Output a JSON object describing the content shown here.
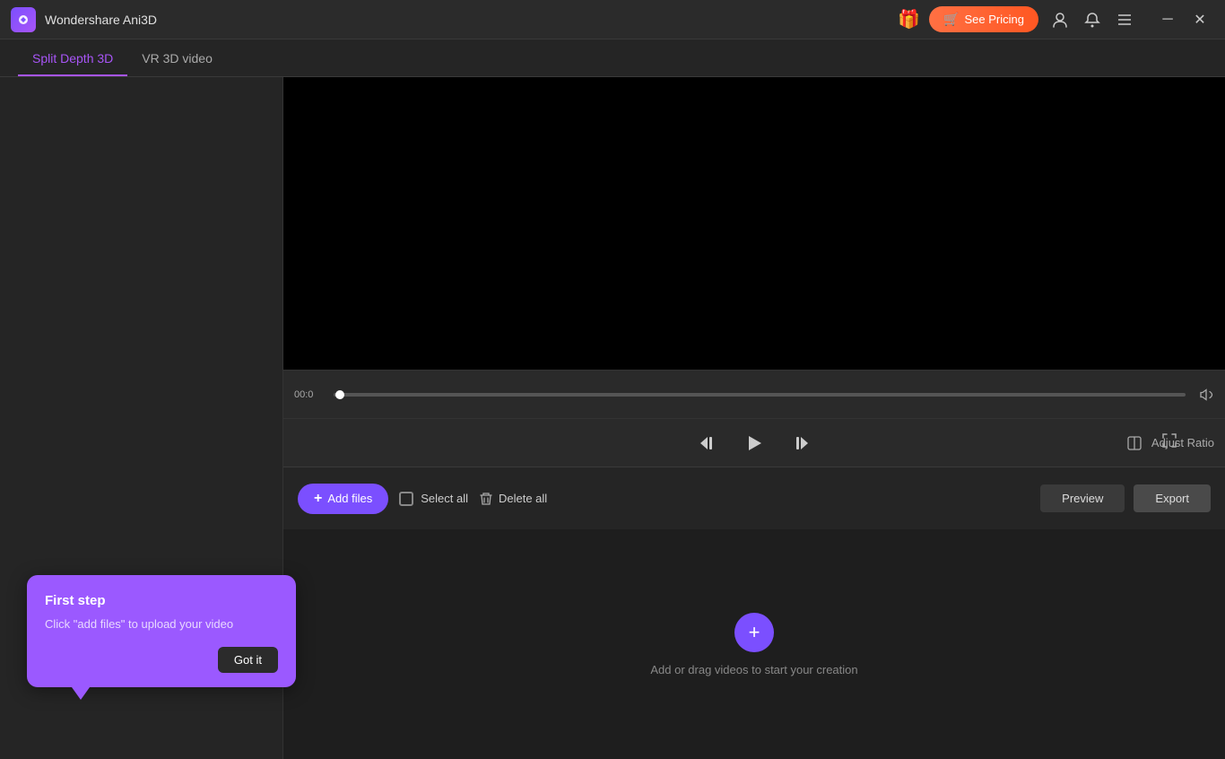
{
  "titleBar": {
    "appName": "Wondershare Ani3D",
    "giftIcon": "🎁",
    "seePricingLabel": "See Pricing",
    "cartIcon": "🛒",
    "userIcon": "👤",
    "bellIcon": "🔔",
    "menuIcon": "≡",
    "minimizeIcon": "─",
    "closeIcon": "✕"
  },
  "tabs": [
    {
      "label": "Split Depth 3D",
      "active": true
    },
    {
      "label": "VR 3D video",
      "active": false
    }
  ],
  "timeline": {
    "timeStart": "00:0"
  },
  "controls": {
    "skipBackIcon": "⏮",
    "playIcon": "▶",
    "skipForwardIcon": "⏭",
    "fullscreenIcon": "⛶",
    "adjustRatioLabel": "Adjust Ratio"
  },
  "fileBar": {
    "addFilesLabel": "Add files",
    "selectAllLabel": "Select all",
    "deleteAllLabel": "Delete all",
    "previewLabel": "Preview",
    "exportLabel": "Export"
  },
  "dropZone": {
    "plusIcon": "+",
    "dropText": "Add or drag videos to start your creation"
  },
  "popup": {
    "title": "First step",
    "description": "Click \"add files\" to upload your video",
    "gotItLabel": "Got it"
  }
}
